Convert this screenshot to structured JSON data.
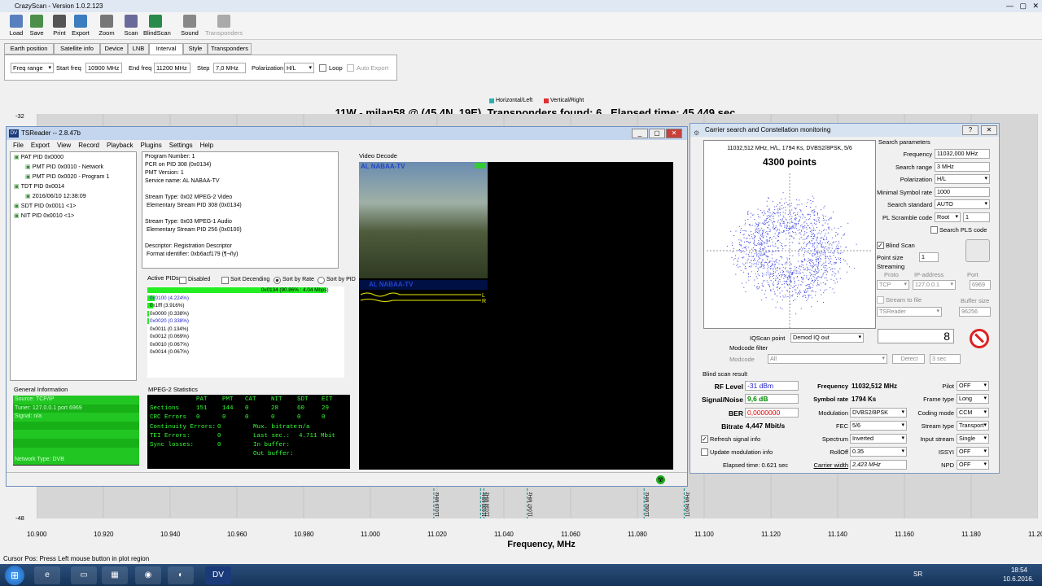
{
  "app_title": "CrazyScan - Version 1.0.2.123",
  "toolbar": [
    "Load",
    "Save",
    "Print",
    "Export",
    "Zoom",
    "Scan",
    "BlindScan",
    "Sound",
    "Transponders"
  ],
  "tabs": [
    "Earth position",
    "Satellite info",
    "Device",
    "LNB",
    "Interval",
    "Style",
    "Transponders"
  ],
  "interval": {
    "mode": "Freq range",
    "start_label": "Start freq",
    "start": "10900 MHz",
    "end_label": "End freq",
    "end": "11200 MHz",
    "step_label": "Step",
    "step": "7,0 MHz",
    "pol_label": "Polarization",
    "pol": "H/L",
    "loop": "Loop",
    "auto_export": "Auto Export"
  },
  "legend": {
    "h": "Horizontal/Left",
    "v": "Vertical/Right",
    "h_color": "#2ab0b0",
    "v_color": "#e03030"
  },
  "plot_title": "11W - milan58 @  (45.4N, 19E). Transponders found: 6 , Elapsed time: 45.449 sec",
  "y_ticks": [
    "-32",
    "-48"
  ],
  "x_ticks": [
    "10.900",
    "10.920",
    "10.940",
    "10.960",
    "10.980",
    "11.000",
    "11.020",
    "11.040",
    "11.060",
    "11.080",
    "11.100",
    "11.120",
    "11.140",
    "11.160",
    "11.180",
    "11.200"
  ],
  "x_label": "Frequency, MHz",
  "markers": [
    {
      "f": "11019 MHz",
      "x": 11019
    },
    {
      "f": "11033 MHz",
      "x": 11033
    },
    {
      "f": "11034 MHz",
      "x": 11034
    },
    {
      "f": "11047 MHz",
      "x": 11047
    },
    {
      "f": "11082 MHz",
      "x": 11082
    },
    {
      "f": "11094 MHz",
      "x": 11094
    }
  ],
  "status": "Cursor Pos: Press Left mouse button in plot region",
  "ts": {
    "title": "TSReader -- 2.8.47b",
    "menu": [
      "File",
      "Export",
      "View",
      "Record",
      "Playback",
      "Plugins",
      "Settings",
      "Help"
    ],
    "tree": [
      "PAT PID 0x0000",
      "PMT PID 0x0010 - Network",
      "PMT PID 0x0020 - Program 1",
      "TDT PID 0x0014",
      "2016/06/10 12:38:09",
      "SDT PID 0x0011 <1>",
      "NIT PID 0x0010 <1>"
    ],
    "info": "Program Number: 1\nPCR on PID 308 (0x0134)\nPMT Version: 1\nService name: AL NABAA-TV\n\nStream Type: 0x02 MPEG-2 Video\n Elementary Stream PID 308 (0x0134)\n\nStream Type: 0x03 MPEG-1 Audio\n Elementary Stream PID 256 (0x0100)\n\nDescriptor: Registration Descriptor\n Format identifier: 0xb6acf179 (¶¬ñy)",
    "video_label": "Video Decode",
    "channel": "AL NABAA-TV",
    "active_pids": "Active PIDs",
    "opts": [
      "Disabled",
      "Sort Decending",
      "Sort by Rate",
      "Sort by PID"
    ],
    "pids": [
      {
        "t": "0x0134 (90.86% : 4.04 Mbps)",
        "p": 100
      },
      {
        "t": "0x0100 (4.224%)",
        "p": 5
      },
      {
        "t": "0x1fff (3.916%)",
        "p": 4
      },
      {
        "t": "0x0000 (0.338%)",
        "p": 1
      },
      {
        "t": "0x0020 (0.338%)",
        "p": 1
      },
      {
        "t": "0x0011 (0.134%)",
        "p": 0
      },
      {
        "t": "0x0012 (0.069%)",
        "p": 0
      },
      {
        "t": "0x0010 (0.067%)",
        "p": 0
      },
      {
        "t": "0x0014 (0.067%)",
        "p": 0
      }
    ],
    "general_info": "General Information",
    "gen": [
      "Source: TCP/IP",
      "Tuner: 127.0.0.1 port 6969",
      "Signal: n/a",
      "",
      "",
      "",
      "",
      "Network Type: DVB"
    ],
    "mpeg_stats": "MPEG-2 Statistics",
    "stat_cols": [
      "PAT",
      "PMT",
      "CAT",
      "NIT",
      "SDT",
      "EIT"
    ],
    "sections": [
      "Sections",
      "151",
      "144",
      "0",
      "28",
      "60",
      "29"
    ],
    "crc": [
      "CRC Errors",
      "0",
      "0",
      "0",
      "0",
      "0",
      "0"
    ],
    "cont": "Continuity Errors:",
    "cont_v": "0",
    "tei": "TEI Errors:",
    "tei_v": "0",
    "sync": "Sync losses:",
    "sync_v": "0",
    "mux": "Mux. bitrate:",
    "mux_v": "n/a",
    "last": "Last sec.:",
    "last_v": "4.711 Mbit",
    "inbuf": "In buffer:",
    "outbuf": "Out buffer:"
  },
  "cs": {
    "title": "Carrier search and Constellation monitoring",
    "header": "11032,512 MHz, H/L, 1794 Ks, DVBS2/8PSK, 5/6",
    "points": "4300 points",
    "sp": "Search parameters",
    "freq_l": "Frequency",
    "freq": "11032,000 MHz",
    "range_l": "Search range",
    "range": "3 MHz",
    "pol_l": "Polarization",
    "pol": "H/L",
    "msr_l": "Minimal Symbol rate",
    "msr": "1000",
    "std_l": "Search standard",
    "std": "AUTO",
    "pls_l": "PL Scramble code",
    "pls": "Root",
    "pls_n": "1",
    "pls_chk": "Search PLS code",
    "blind": "Blind Scan",
    "ps_l": "Point size",
    "ps": "1",
    "streaming": "Streaming",
    "proto_l": "Proto",
    "proto": "TCP",
    "ip_l": "IP-address",
    "ip": "127.0.0.1",
    "port_l": "Port",
    "port": "6969",
    "stf": "Stream to file",
    "buf_l": "Buffer size",
    "app": "TSReader",
    "buf": "96256",
    "big": "8",
    "iqp_l": "IQScan point",
    "iqp": "Demod IQ out",
    "mcf": "Modcode filter",
    "mc_l": "Modcode",
    "mc": "All",
    "detect": "Detect",
    "sec": "3 sec",
    "bsr": "Blind scan result",
    "rf_l": "RF Level",
    "rf": "-31 dBm",
    "sn_l": "Signal/Noise",
    "sn": "9,6 dB",
    "ber_l": "BER",
    "ber": "0,0000000",
    "br_l": "Bitrate",
    "br": "4,447 Mbit/s",
    "rsi": "Refresh signal info",
    "umi": "Update modulation info",
    "elapsed": "Elapsed time: 0.621 sec",
    "f_l": "Frequency",
    "f": "11032,512 MHz",
    "sr_l": "Symbol rate",
    "sr": "1794 Ks",
    "mod_l": "Modulation",
    "mod": "DVBS2/8PSK",
    "fec_l": "FEC",
    "fec": "5/6",
    "spec_l": "Spectrum",
    "spec": "Inverted",
    "ro_l": "RollOff",
    "ro": "0.35",
    "cw_l": "Carrier width",
    "cw": "2,423 MHz",
    "pilot_l": "Pilot",
    "pilot": "OFF",
    "ft_l": "Frame type",
    "ft": "Long",
    "cm_l": "Coding mode",
    "cm": "CCM",
    "st_l": "Stream type",
    "st": "Transport",
    "is_l": "Input stream",
    "is": "Single",
    "issy_l": "ISSYI",
    "issy": "OFF",
    "npd_l": "NPD",
    "npd": "OFF"
  },
  "tray": {
    "lang": "SR",
    "time": "18:54",
    "date": "10.6.2016."
  }
}
